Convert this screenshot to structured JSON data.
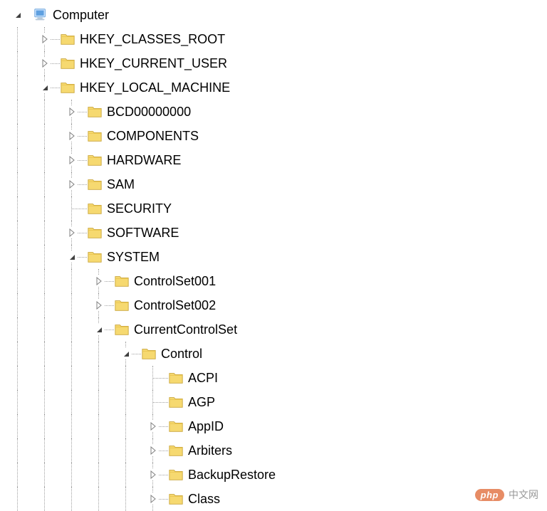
{
  "tree": {
    "root_label": "Computer",
    "hkcr": "HKEY_CLASSES_ROOT",
    "hkcu": "HKEY_CURRENT_USER",
    "hklm": "HKEY_LOCAL_MACHINE",
    "bcd": "BCD00000000",
    "components": "COMPONENTS",
    "hardware": "HARDWARE",
    "sam": "SAM",
    "security": "SECURITY",
    "software": "SOFTWARE",
    "system": "SYSTEM",
    "cs001": "ControlSet001",
    "cs002": "ControlSet002",
    "ccs": "CurrentControlSet",
    "control": "Control",
    "acpi": "ACPI",
    "agp": "AGP",
    "appid": "AppID",
    "arbiters": "Arbiters",
    "backuprestore": "BackupRestore",
    "class": "Class"
  },
  "watermark": {
    "badge": "php",
    "text": "中文网"
  }
}
